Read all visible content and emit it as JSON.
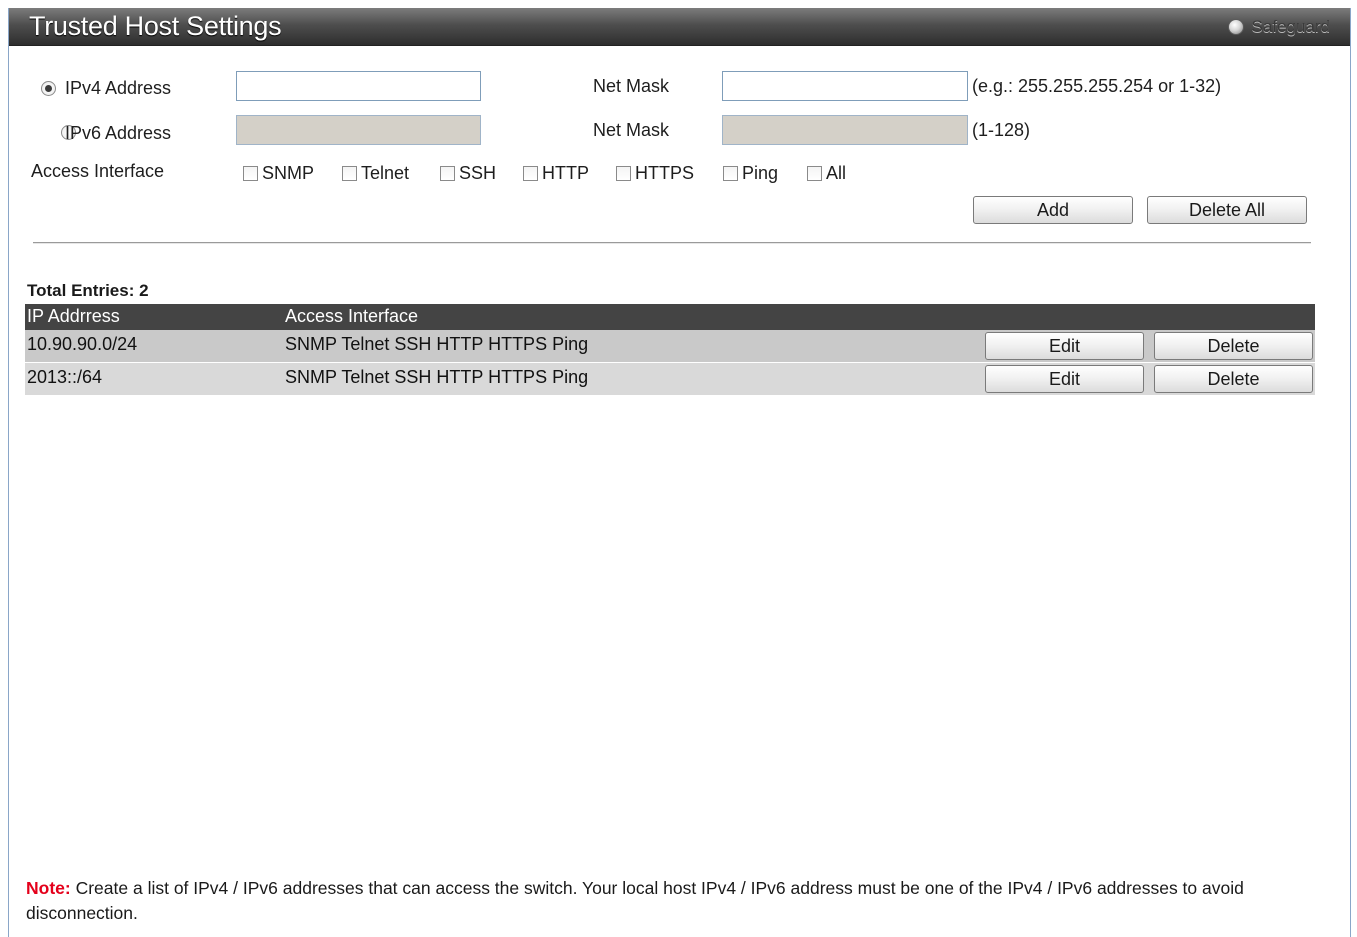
{
  "header": {
    "title": "Trusted Host Settings",
    "safeguard_label": "Safeguard"
  },
  "form": {
    "ipv4_label": "IPv4 Address",
    "ipv6_label": "IPv6 Address",
    "ipv4_value": "",
    "ipv6_value": "",
    "netmask_label_1": "Net Mask",
    "netmask_label_2": "Net Mask",
    "netmask_v4_value": "",
    "netmask_v6_value": "",
    "netmask_v4_hint": "(e.g.: 255.255.255.254 or 1-32)",
    "netmask_v6_hint": "(1-128)",
    "access_interface_label": "Access Interface",
    "interfaces": [
      "SNMP",
      "Telnet",
      "SSH",
      "HTTP",
      "HTTPS",
      "Ping",
      "All"
    ],
    "add_label": "Add",
    "delete_all_label": "Delete All"
  },
  "table": {
    "total_entries": "Total Entries: 2",
    "columns": [
      "IP Addrress",
      "Access Interface"
    ],
    "rows": [
      {
        "ip": "10.90.90.0/24",
        "access": "SNMP Telnet SSH HTTP HTTPS Ping",
        "edit": "Edit",
        "delete": "Delete"
      },
      {
        "ip": "2013::/64",
        "access": "SNMP Telnet SSH HTTP HTTPS Ping",
        "edit": "Edit",
        "delete": "Delete"
      }
    ]
  },
  "note": {
    "label": "Note:",
    "text": " Create a list of IPv4 / IPv6 addresses that can access the switch. Your local host IPv4 / IPv6 address must be one of the IPv4 / IPv6 addresses to avoid disconnection."
  },
  "colors": {
    "header_bg": "#3a3a3a",
    "table_header_bg": "#444444",
    "row_bg": "#c9c9c9",
    "row_alt_bg": "#d9d9d9",
    "note_label": "#e4001b"
  }
}
